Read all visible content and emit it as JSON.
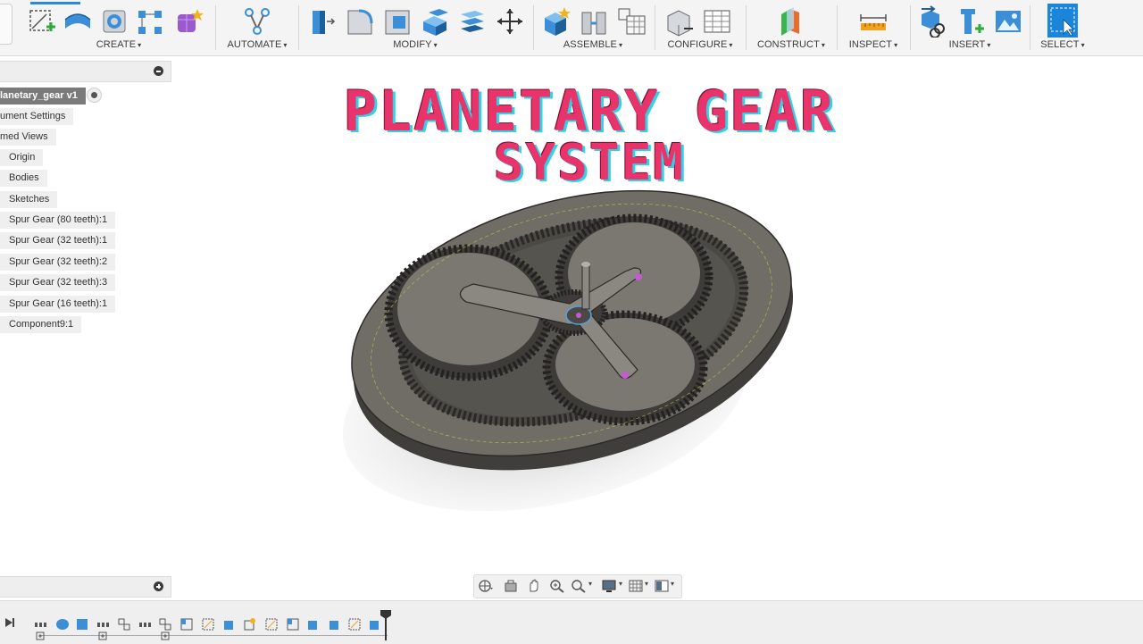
{
  "toolbar": {
    "groups": [
      {
        "id": "create",
        "label": "CREATE"
      },
      {
        "id": "automate",
        "label": "AUTOMATE"
      },
      {
        "id": "modify",
        "label": "MODIFY"
      },
      {
        "id": "assemble",
        "label": "ASSEMBLE"
      },
      {
        "id": "configure",
        "label": "CONFIGURE"
      },
      {
        "id": "construct",
        "label": "CONSTRUCT"
      },
      {
        "id": "inspect",
        "label": "INSPECT"
      },
      {
        "id": "insert",
        "label": "INSERT"
      },
      {
        "id": "select",
        "label": "SELECT"
      }
    ],
    "caret": "▾"
  },
  "browser": {
    "root": "lanetary_gear v1",
    "items": [
      {
        "label": "ument Settings"
      },
      {
        "label": "med Views"
      },
      {
        "label": "Origin"
      },
      {
        "label": "Bodies"
      },
      {
        "label": "Sketches"
      },
      {
        "label": "Spur Gear (80 teeth):1"
      },
      {
        "label": "Spur Gear (32 teeth):1"
      },
      {
        "label": "Spur Gear (32 teeth):2"
      },
      {
        "label": "Spur Gear (32 teeth):3"
      },
      {
        "label": "Spur Gear (16 teeth):1"
      },
      {
        "label": "Component9:1"
      }
    ]
  },
  "overlay": {
    "title_line1": "PLANETARY GEAR",
    "title_line2": "SYSTEM"
  },
  "colors": {
    "accent": "#2a8ad4",
    "title": "#e8336b",
    "title_shadow": "#2fd3e6",
    "gear_fill": "#6e6c65",
    "gear_dark": "#3d3c38"
  },
  "icons": {
    "navbar": [
      "orbit-icon",
      "look-at-icon",
      "pan-icon",
      "zoom-icon",
      "zoom-window-icon",
      "display-settings-icon",
      "grid-icon",
      "viewports-icon"
    ],
    "timeline": [
      "play-end-icon",
      "timeline-marker-icon"
    ]
  }
}
